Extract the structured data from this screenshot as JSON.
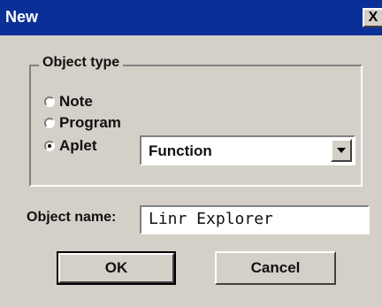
{
  "window": {
    "title": "New",
    "close_glyph": "X"
  },
  "object_type": {
    "group_label": "Object type",
    "options": [
      {
        "label": "Note",
        "checked": false
      },
      {
        "label": "Program",
        "checked": false
      },
      {
        "label": "Aplet",
        "checked": true
      }
    ],
    "aplet_select": {
      "value": "Function"
    }
  },
  "object_name": {
    "label": "Object name:",
    "value": "Linr Explorer"
  },
  "buttons": {
    "ok": "OK",
    "cancel": "Cancel"
  },
  "colors": {
    "titlebar": "#0a2f96",
    "face": "#d4d0c8"
  }
}
